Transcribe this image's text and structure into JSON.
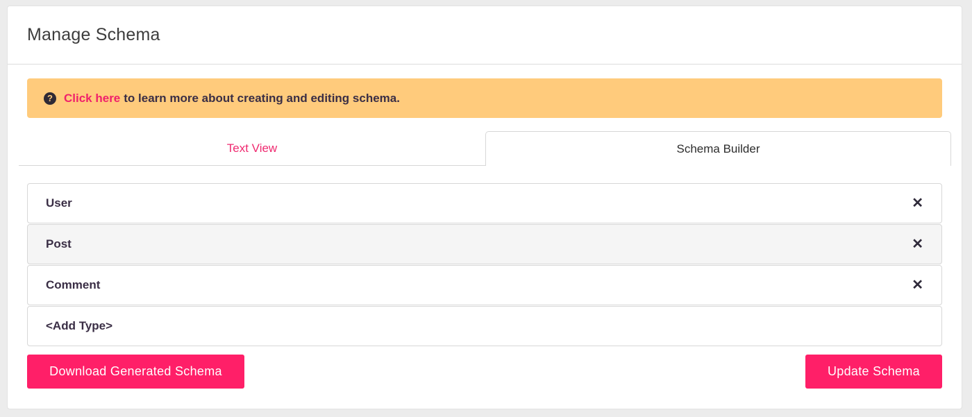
{
  "header": {
    "title": "Manage Schema"
  },
  "notice": {
    "icon": "question-circle-icon",
    "link_text": "Click here",
    "text": "to learn more about creating and editing schema."
  },
  "tabs": [
    {
      "label": "Text View",
      "active": false
    },
    {
      "label": "Schema Builder",
      "active": true
    }
  ],
  "types": [
    {
      "name": "User",
      "removable": true
    },
    {
      "name": "Post",
      "removable": true
    },
    {
      "name": "Comment",
      "removable": true
    },
    {
      "name": "<Add Type>",
      "removable": false
    }
  ],
  "close_glyph": "✕",
  "actions": {
    "download_label": "Download Generated Schema",
    "update_label": "Update Schema"
  },
  "colors": {
    "accent": "#ff1f68",
    "notice_bg": "#ffcb7c",
    "link": "#f0216b"
  }
}
